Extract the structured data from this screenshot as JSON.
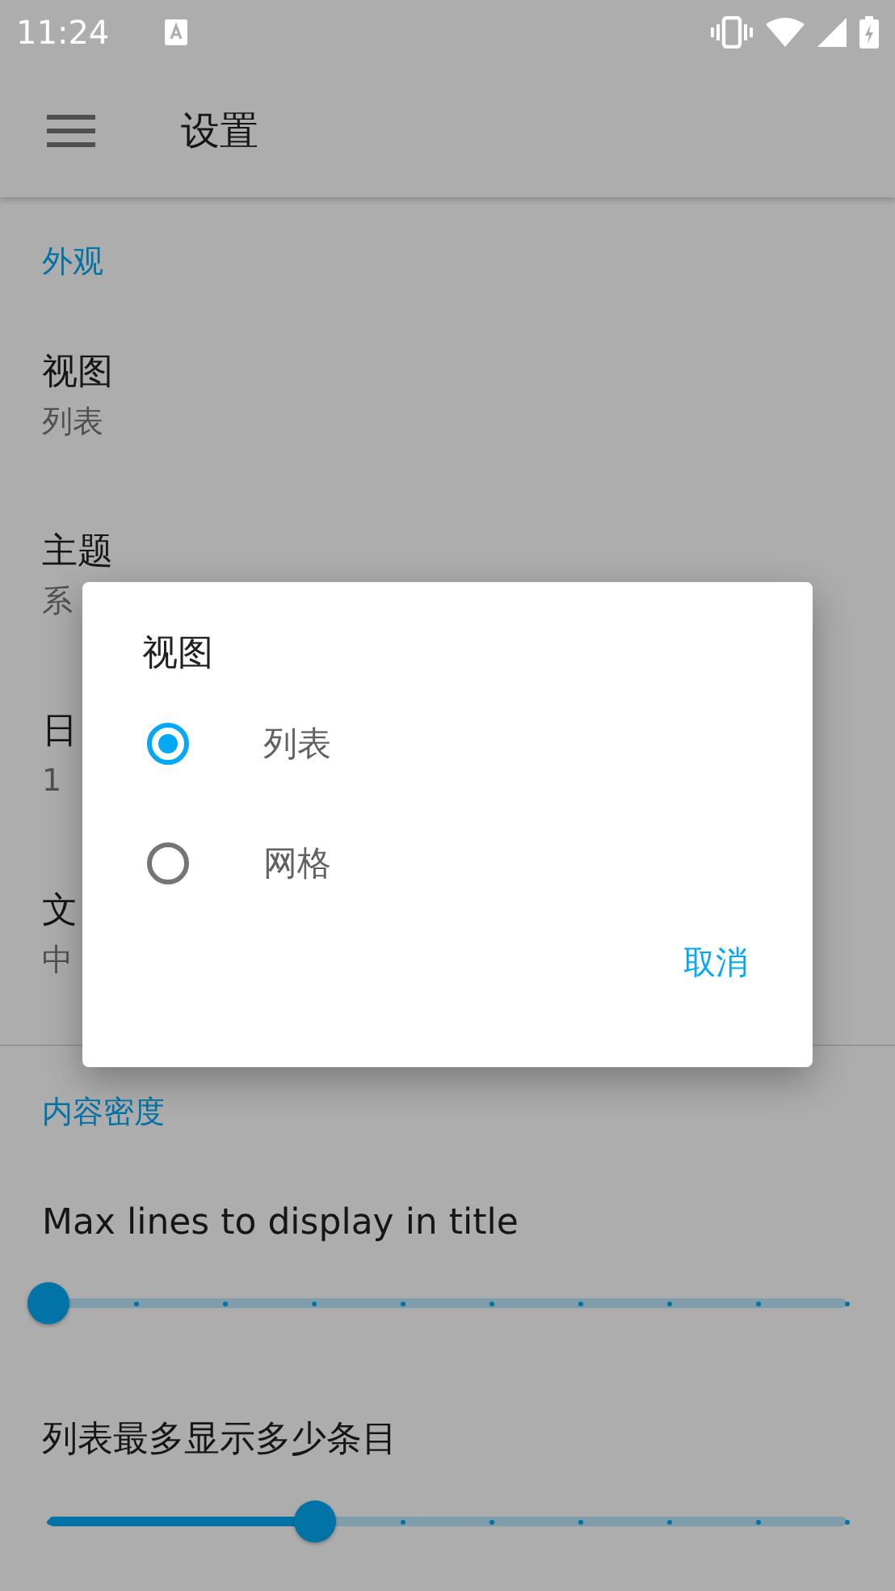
{
  "status_bar": {
    "time": "11:24"
  },
  "app_bar": {
    "title": "设置"
  },
  "sections": [
    {
      "header": "外观",
      "items": [
        {
          "kind": "text",
          "title": "视图",
          "summary": "列表"
        },
        {
          "kind": "text",
          "title": "主题",
          "summary": "系"
        },
        {
          "kind": "text",
          "title": "日",
          "summary": "1"
        },
        {
          "kind": "text",
          "title": "文",
          "summary": "中"
        }
      ]
    },
    {
      "header": "内容密度",
      "items": [
        {
          "kind": "slider",
          "title": "Max lines to display in title",
          "level": 0
        },
        {
          "kind": "slider",
          "title": "列表最多显示多少条目",
          "level": 0.333
        }
      ]
    }
  ],
  "dialog": {
    "title": "视图",
    "options": [
      {
        "label": "列表",
        "selected": true
      },
      {
        "label": "网格",
        "selected": false
      }
    ],
    "buttons": [
      "取消"
    ]
  }
}
